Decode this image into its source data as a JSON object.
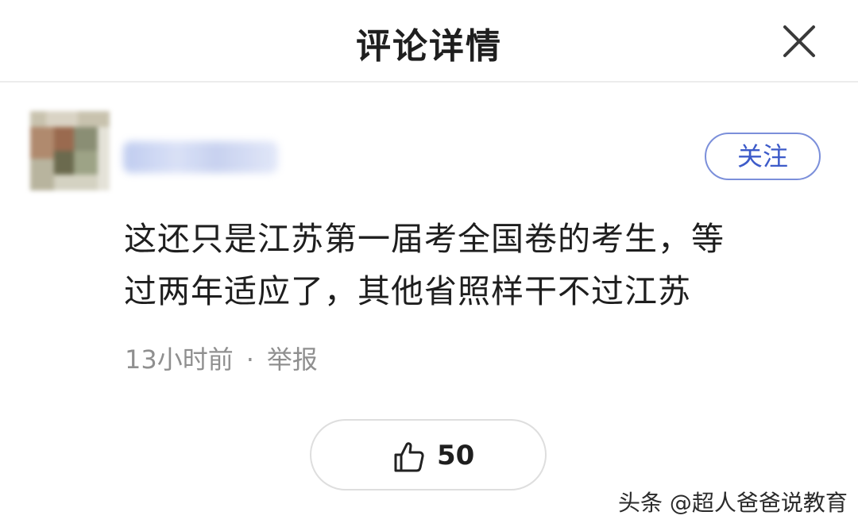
{
  "header": {
    "title": "评论详情",
    "close_icon": "close-icon"
  },
  "comment": {
    "follow_label": "关注",
    "lines": [
      "这还只是江苏第一届考全国卷的考生，等",
      "过两年适应了，其他省照样干不过江苏"
    ],
    "time": "13小时前",
    "separator": "·",
    "report_label": "举报"
  },
  "like": {
    "icon": "thumbs-up-icon",
    "count": "50"
  },
  "watermark": "头条 @超人爸爸说教育",
  "colors": {
    "accent": "#3d5bc9",
    "accent_border": "#7b8fda",
    "meta_text": "#8f8f8f",
    "divider": "#ececec"
  }
}
